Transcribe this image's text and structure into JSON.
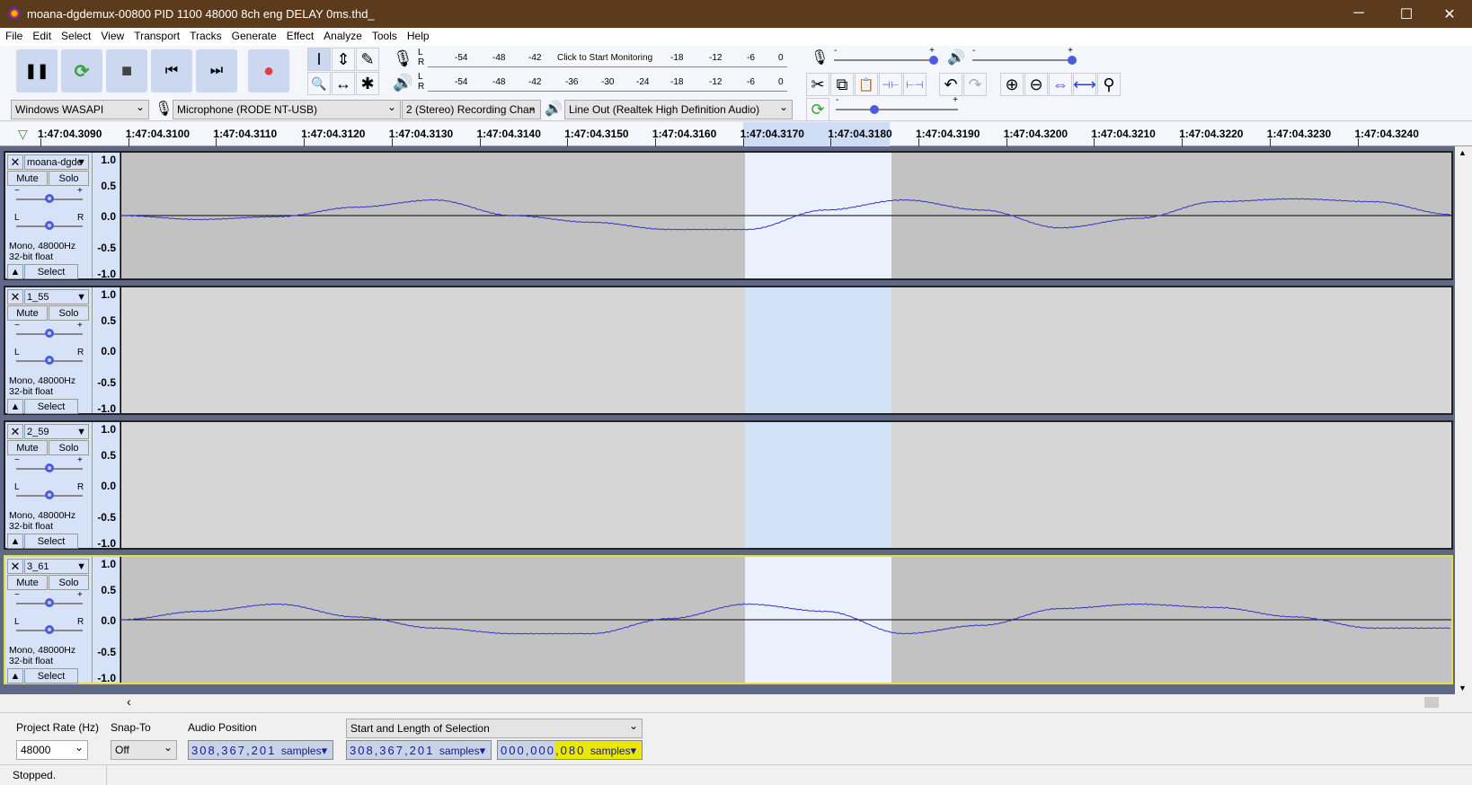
{
  "window": {
    "title": "moana-dgdemux-00800 PID 1100 48000 8ch eng DELAY 0ms.thd_",
    "minimize": "─",
    "maximize": "☐",
    "close": "✕"
  },
  "menu": [
    "File",
    "Edit",
    "Select",
    "View",
    "Transport",
    "Tracks",
    "Generate",
    "Effect",
    "Analyze",
    "Tools",
    "Help"
  ],
  "transport": {
    "pause": "❚❚",
    "loop": "⟳",
    "stop": "■",
    "skip_start": "⏮",
    "skip_end": "⏭",
    "record": "●",
    "record_color": "#e04040",
    "loop_color": "#3aa03a"
  },
  "tools": [
    "I",
    "⇕",
    "✎",
    "🔍",
    "↔",
    "✱"
  ],
  "meters": {
    "record_ticks": [
      "-54",
      "-48",
      "-42",
      "-18",
      "-12",
      "-6",
      "0"
    ],
    "record_prompt": "Click to Start Monitoring",
    "play_ticks": [
      "-54",
      "-48",
      "-42",
      "-36",
      "-30",
      "-24",
      "-18",
      "-12",
      "-6",
      "0"
    ],
    "L": "L",
    "R": "R"
  },
  "mixer": {
    "minus": "-",
    "plus": "+",
    "record_volume": 1.0,
    "playback_volume": 1.0
  },
  "edit_tools": [
    "✂",
    "⧉",
    "📋",
    "⊣⊢",
    "⊢⊣",
    "↶",
    "↷",
    "⊕",
    "⊖",
    "⇔",
    "⟷",
    "⚲"
  ],
  "play_at_speed": {
    "minus": "-",
    "plus": "+",
    "speed": 0.3
  },
  "devices": {
    "host": "Windows WASAPI",
    "recording_device": "Microphone (RODE NT-USB)",
    "channels": "2 (Stereo) Recording Chan",
    "playback_device": "Line Out (Realtek High Definition Audio)"
  },
  "ruler": {
    "labels": [
      "1:47:04.3090",
      "1:47:04.3100",
      "1:47:04.3110",
      "1:47:04.3120",
      "1:47:04.3130",
      "1:47:04.3140",
      "1:47:04.3150",
      "1:47:04.3160",
      "1:47:04.3170",
      "1:47:04.3180",
      "1:47:04.3190",
      "1:47:04.3200",
      "1:47:04.3210",
      "1:47:04.3220",
      "1:47:04.3230",
      "1:47:04.3240"
    ]
  },
  "vruler": [
    "1.0",
    "0.5",
    "0.0",
    "-0.5",
    "-1.0"
  ],
  "tracks": [
    {
      "name": "moana-dgde",
      "mute": "Mute",
      "solo": "Solo",
      "info1": "Mono, 48000Hz",
      "info2": "32-bit float",
      "select": "Select",
      "focused": false,
      "amplitudes": [
        0,
        -0.07,
        -0.02,
        0.15,
        0.28,
        0.0,
        -0.12,
        -0.25,
        -0.25,
        0.1,
        0.28,
        0.1,
        -0.22,
        -0.05,
        0.25,
        0.3,
        0.25,
        0.02
      ]
    },
    {
      "name": "1_55",
      "mute": "Mute",
      "solo": "Solo",
      "info1": "Mono, 48000Hz",
      "info2": "32-bit float",
      "select": "Select",
      "focused": false,
      "amplitudes": []
    },
    {
      "name": "2_59",
      "mute": "Mute",
      "solo": "Solo",
      "info1": "Mono, 48000Hz",
      "info2": "32-bit float",
      "select": "Select",
      "focused": false,
      "amplitudes": []
    },
    {
      "name": "3_61",
      "mute": "Mute",
      "solo": "Solo",
      "info1": "Mono, 48000Hz",
      "info2": "32-bit float",
      "select": "Select",
      "focused": true,
      "amplitudes": [
        0,
        0.15,
        0.28,
        0.05,
        -0.15,
        -0.25,
        -0.25,
        0.02,
        0.28,
        0.15,
        -0.25,
        -0.1,
        0.2,
        0.28,
        0.22,
        0.05,
        -0.15,
        -0.15
      ]
    }
  ],
  "selectionbar": {
    "project_rate_label": "Project Rate (Hz)",
    "project_rate": "48000",
    "snap_label": "Snap-To",
    "snap": "Off",
    "audio_position_label": "Audio Position",
    "audio_position": "308,367,201",
    "selection_mode": "Start and Length of Selection",
    "selection_start": "308,367,201",
    "selection_length": "000,000,080",
    "unit": "samples"
  },
  "status": "Stopped.",
  "colors": {
    "waveform": "#3232c8",
    "titlebar": "#5c3a1c",
    "highlight": "#f0f000"
  }
}
